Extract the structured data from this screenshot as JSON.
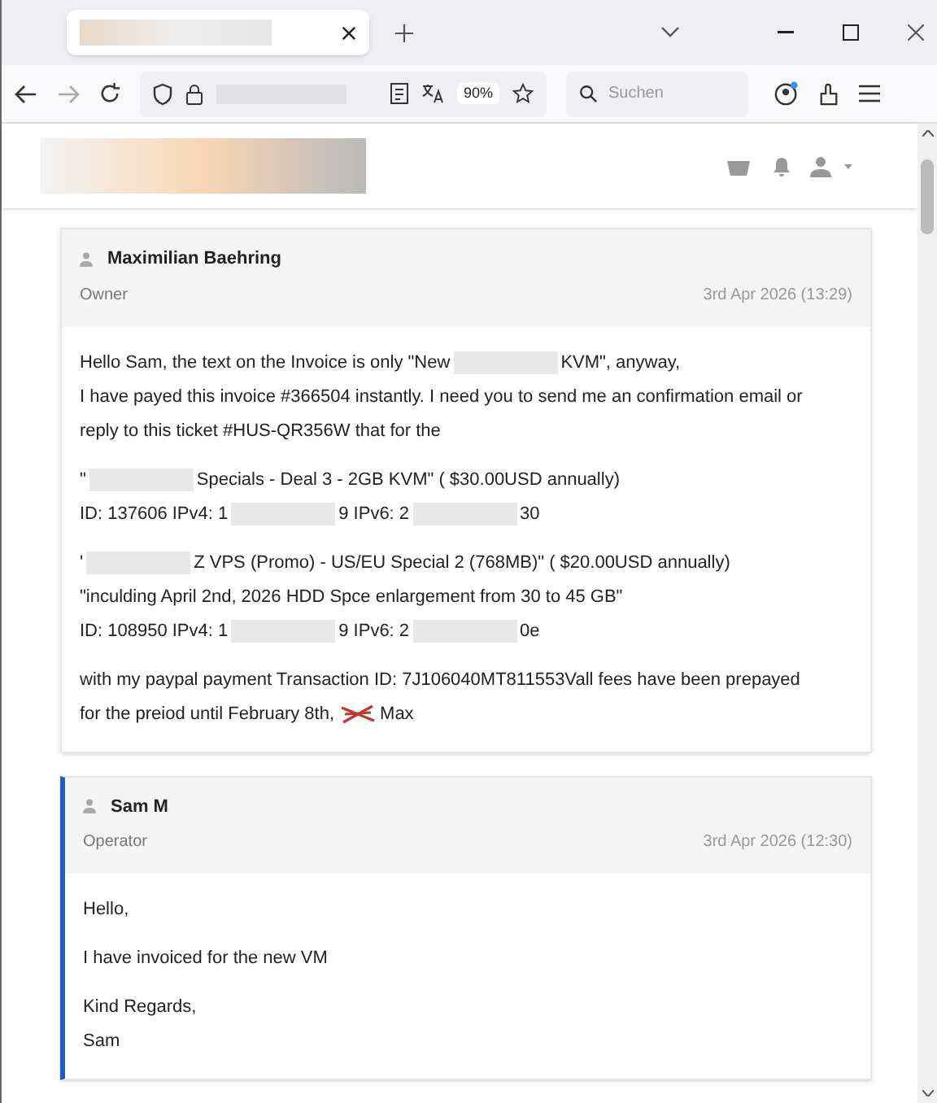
{
  "browser": {
    "zoom": "90%",
    "search_placeholder": "Suchen"
  },
  "messages": [
    {
      "author": "Maximilian Baehring",
      "role": "Owner",
      "date": "3rd Apr 2026 (13:29)",
      "staff": false,
      "paragraphs": [
        [
          [
            {
              "kind": "text",
              "text": "Hello Sam, the text on the Invoice is only \"New"
            },
            {
              "kind": "redacted"
            },
            {
              "kind": "text",
              "text": "KVM\", anyway,"
            }
          ],
          [
            {
              "kind": "text",
              "text": "I have payed this invoice #366504 instantly. I need you to send me an confirmation email or"
            }
          ],
          [
            {
              "kind": "text",
              "text": "reply to this ticket #HUS-QR356W that for the"
            }
          ]
        ],
        [
          [
            {
              "kind": "text",
              "text": "\""
            },
            {
              "kind": "redacted"
            },
            {
              "kind": "text",
              "text": "Specials - Deal 3 - 2GB KVM\" ( $30.00USD annually)"
            }
          ],
          [
            {
              "kind": "text",
              "text": "ID: 137606 IPv4: 1"
            },
            {
              "kind": "redacted"
            },
            {
              "kind": "text",
              "text": "9 IPv6: 2"
            },
            {
              "kind": "redacted"
            },
            {
              "kind": "text",
              "text": "30"
            }
          ]
        ],
        [
          [
            {
              "kind": "text",
              "text": "'"
            },
            {
              "kind": "redacted"
            },
            {
              "kind": "text",
              "text": "Z VPS (Promo) - US/EU Special 2 (768MB)\" ( $20.00USD annually)"
            }
          ],
          [
            {
              "kind": "text",
              "text": "\"inculding April 2nd, 2026 HDD Spce enlargement from 30 to 45 GB\""
            }
          ],
          [
            {
              "kind": "text",
              "text": "ID: 108950 IPv4: 1"
            },
            {
              "kind": "redacted"
            },
            {
              "kind": "text",
              "text": "9 IPv6: 2"
            },
            {
              "kind": "redacted"
            },
            {
              "kind": "text",
              "text": "0e"
            }
          ]
        ],
        [
          [
            {
              "kind": "text",
              "text": "with my paypal payment Transaction ID: 7J106040MT811553Vall fees have been prepayed"
            }
          ],
          [
            {
              "kind": "text",
              "text": "for the preiod until February 8th,"
            },
            {
              "kind": "struck"
            },
            {
              "kind": "text",
              "text": "Max"
            }
          ]
        ]
      ]
    },
    {
      "author": "Sam M",
      "role": "Operator",
      "date": "3rd Apr 2026 (12:30)",
      "staff": true,
      "paragraphs": [
        [
          [
            {
              "kind": "text",
              "text": "Hello,"
            }
          ]
        ],
        [
          [
            {
              "kind": "text",
              "text": "I have invoiced for the new VM"
            }
          ]
        ],
        [
          [
            {
              "kind": "text",
              "text": "Kind Regards,"
            }
          ],
          [
            {
              "kind": "text",
              "text": "Sam"
            }
          ]
        ]
      ]
    }
  ]
}
